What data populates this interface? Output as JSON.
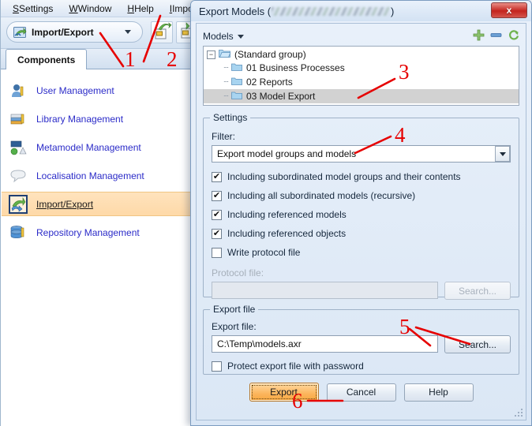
{
  "app": {
    "menubar": [
      {
        "name": "settings",
        "label": "Settings",
        "accel": "S"
      },
      {
        "name": "window",
        "label": "Window",
        "accel": "W"
      },
      {
        "name": "help",
        "label": "Help",
        "accel": "H"
      },
      {
        "name": "import-export",
        "label": "Import/Export",
        "accel": "I"
      }
    ],
    "toolbar": {
      "dropdown_label": "Import/Export",
      "dropdown_icon": "import-export-icon",
      "buttons": [
        {
          "name": "import-button",
          "icon": "import-arrow-icon"
        },
        {
          "name": "export-button",
          "icon": "export-arrow-icon"
        }
      ]
    },
    "tabs": [
      {
        "name": "tab-components",
        "label": "Components",
        "selected": true
      }
    ],
    "components": [
      {
        "name": "user-management",
        "label": "User Management",
        "icon": "user-icon",
        "selected": false
      },
      {
        "name": "library-management",
        "label": "Library Management",
        "icon": "books-icon",
        "selected": false
      },
      {
        "name": "metamodel-management",
        "label": "Metamodel Management",
        "icon": "metamodel-icon",
        "selected": false
      },
      {
        "name": "localisation-management",
        "label": "Localisation Management",
        "icon": "speech-bubble-icon",
        "selected": false
      },
      {
        "name": "import-export",
        "label": "Import/Export",
        "icon": "import-export-icon",
        "selected": true
      },
      {
        "name": "repository-management",
        "label": "Repository Management",
        "icon": "database-icon",
        "selected": false
      }
    ]
  },
  "dialog": {
    "title_prefix": "Export Models (",
    "title_redacted": true,
    "title_suffix": ")",
    "close_label": "x",
    "models": {
      "header_label": "Models",
      "header_icons": [
        {
          "name": "add-icon",
          "color": "#7aba5e"
        },
        {
          "name": "remove-icon",
          "color": "#4f86c6"
        },
        {
          "name": "refresh-icon",
          "color": "#6eb24e"
        }
      ],
      "tree": [
        {
          "name": "tree-node-standard-group",
          "label": "(Standard group)",
          "level": 0,
          "expanded": true,
          "selected": false
        },
        {
          "name": "tree-node-business-processes",
          "label": "01 Business Processes",
          "level": 1,
          "selected": false
        },
        {
          "name": "tree-node-reports",
          "label": "02 Reports",
          "level": 1,
          "selected": false
        },
        {
          "name": "tree-node-model-export",
          "label": "03 Model Export",
          "level": 1,
          "selected": true
        }
      ]
    },
    "settings": {
      "legend": "Settings",
      "filter_label": "Filter:",
      "filter_value": "Export model groups and models",
      "checkboxes": [
        {
          "name": "cb-subordinated-groups",
          "label": "Including subordinated model groups and their contents",
          "checked": true
        },
        {
          "name": "cb-subordinated-models",
          "label": "Including all subordinated models (recursive)",
          "checked": true
        },
        {
          "name": "cb-referenced-models",
          "label": "Including referenced models",
          "checked": true
        },
        {
          "name": "cb-referenced-objects",
          "label": "Including referenced objects",
          "checked": true
        },
        {
          "name": "cb-write-protocol",
          "label": "Write protocol file",
          "checked": false
        }
      ],
      "protocol_label": "Protocol file:",
      "protocol_value": "",
      "protocol_search_label": "Search...",
      "protocol_disabled": true
    },
    "export_file": {
      "legend": "Export file",
      "label": "Export file:",
      "value": "C:\\Temp\\models.axr",
      "search_label": "Search...",
      "protect_checkbox": {
        "name": "cb-protect-password",
        "label": "Protect export file with password",
        "checked": false
      }
    },
    "buttons": {
      "export": "Export",
      "cancel": "Cancel",
      "help": "Help"
    }
  },
  "annotations": [
    {
      "name": "annotation-1",
      "number": "1"
    },
    {
      "name": "annotation-2",
      "number": "2"
    },
    {
      "name": "annotation-3",
      "number": "3"
    },
    {
      "name": "annotation-4",
      "number": "4"
    },
    {
      "name": "annotation-5",
      "number": "5"
    },
    {
      "name": "annotation-6",
      "number": "6"
    }
  ],
  "colors": {
    "annotation_red": "#e60000",
    "selection_orange": "#fed9a8",
    "link_blue": "#2b2bc8",
    "tree_selection_gray": "#d2d2d2",
    "export_button_orange": "#fcb55c"
  }
}
